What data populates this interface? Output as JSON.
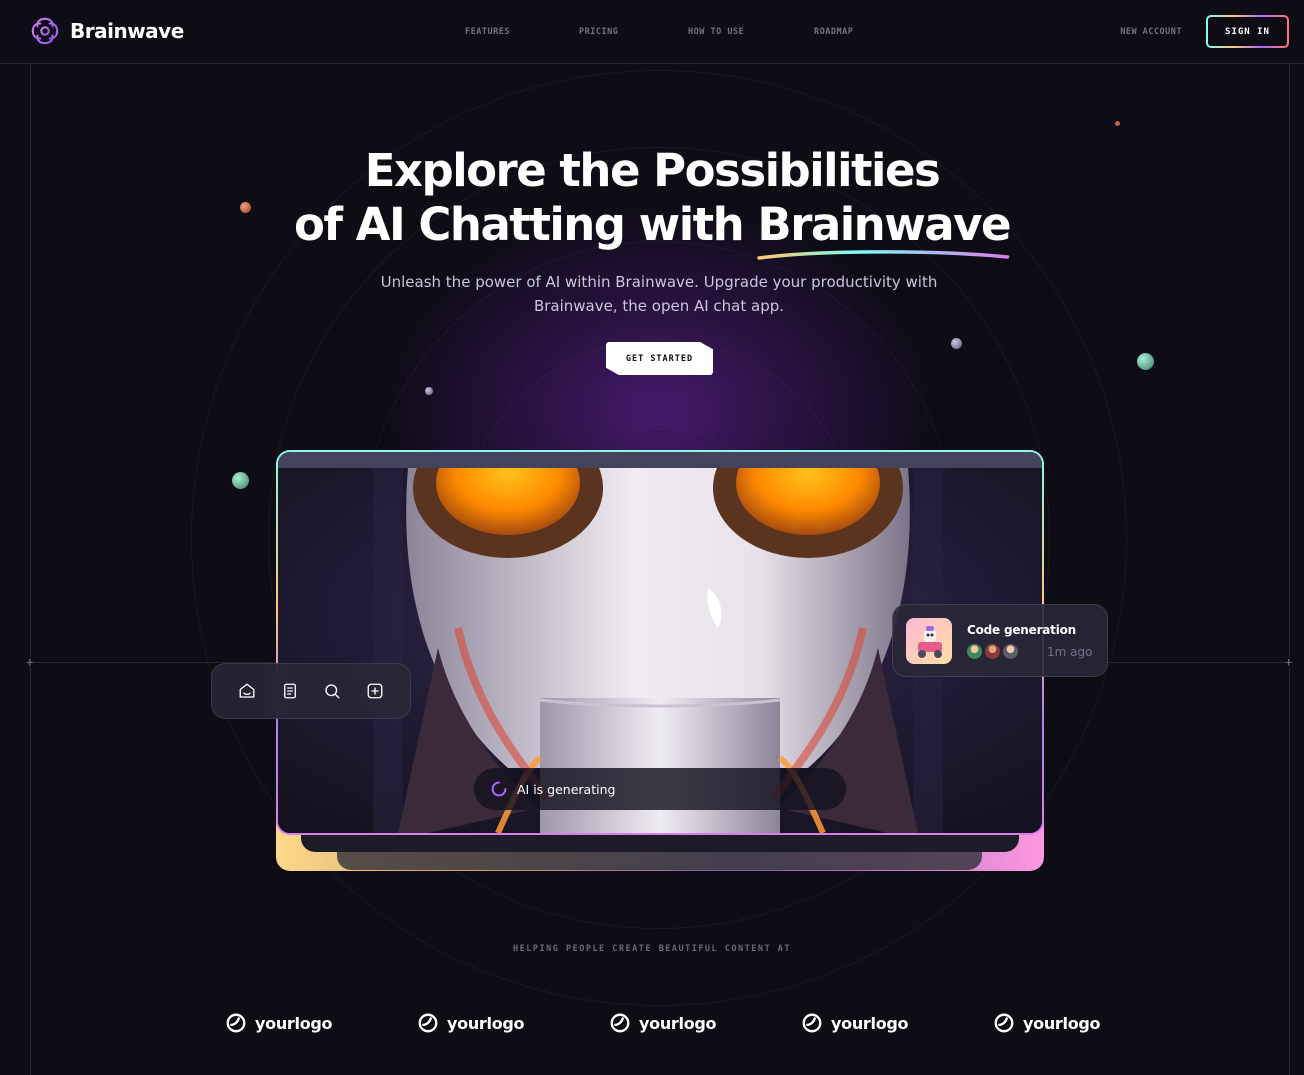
{
  "app": {
    "name": "Brainwave"
  },
  "nav": {
    "items": [
      {
        "label": "FEATURES"
      },
      {
        "label": "PRICING"
      },
      {
        "label": "HOW TO USE"
      },
      {
        "label": "ROADMAP"
      }
    ],
    "new_account": "NEW ACCOUNT",
    "sign_in": "SIGN IN"
  },
  "hero": {
    "title_line1": "Explore the Possibilities",
    "title_line2_prefix": "of AI Chatting with ",
    "title_highlight": "Brainwave",
    "subtitle": "Unleash the power of AI within Brainwave. Upgrade your productivity with Brainwave, the open AI chat app.",
    "cta": "GET STARTED"
  },
  "card": {
    "toolbar_icons": [
      "home-icon",
      "document-icon",
      "search-icon",
      "plus-square-icon"
    ],
    "notification": {
      "title": "Code generation",
      "time": "1m ago",
      "thumbnail": "robot-toy-image"
    },
    "status": "AI is generating"
  },
  "logos": {
    "caption": "HELPING PEOPLE CREATE BEAUTIFUL CONTENT AT",
    "items": [
      "yourlogo",
      "yourlogo",
      "yourlogo",
      "yourlogo",
      "yourlogo"
    ]
  },
  "colors": {
    "background": "#0e0c15",
    "accent_purple": "#ac6aff",
    "accent_cyan": "#79fff7",
    "accent_yellow": "#ffc876",
    "accent_pink": "#ff98e2"
  }
}
